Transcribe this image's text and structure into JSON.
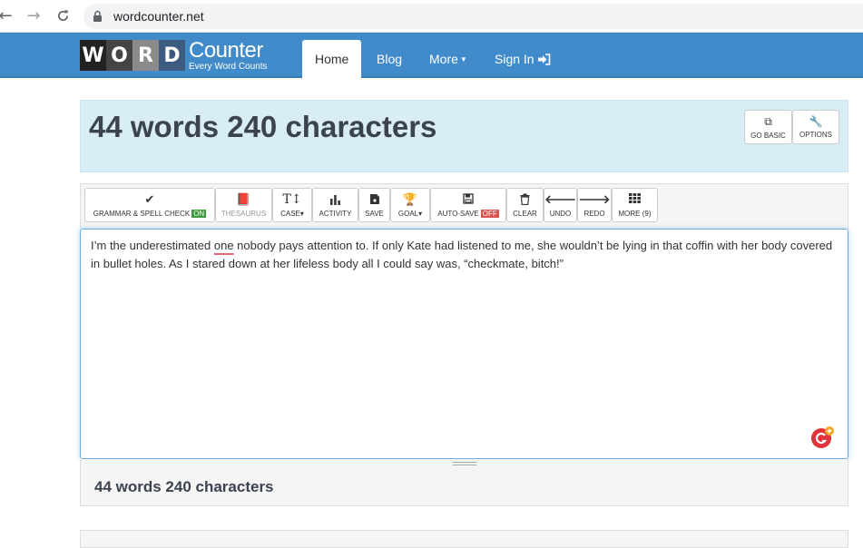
{
  "browser": {
    "url": "wordcounter.net"
  },
  "logo": {
    "letters": [
      "W",
      "O",
      "R",
      "D"
    ],
    "tile_colors": [
      "#222222",
      "#444444",
      "#888888",
      "#3d5a80"
    ],
    "counter": "Counter",
    "tagline": "Every Word Counts"
  },
  "nav": {
    "home": "Home",
    "blog": "Blog",
    "more": "More",
    "sign_in": "Sign In"
  },
  "header": {
    "title": "44 words 240 characters",
    "go_basic": "GO BASIC",
    "options": "OPTIONS"
  },
  "toolbar": {
    "grammar": "GRAMMAR & SPELL CHECK",
    "grammar_badge": "ON",
    "thesaurus": "THESAURUS",
    "case": "CASE",
    "activity": "ACTIVITY",
    "save": "SAVE",
    "goal": "GOAL",
    "auto_save": "AUTO-SAVE",
    "auto_save_badge": "OFF",
    "clear": "CLEAR",
    "undo": "UNDO",
    "redo": "REDO",
    "more": "MORE (9)"
  },
  "editor": {
    "text_before": "I’m the underestimated ",
    "underlined": "one",
    "text_after": " nobody pays attention to. If only Kate had listened to me, she wouldn’t be lying in that coffin with her body covered in bullet holes. As I stared down at her lifeless body all I could say was, “checkmate, bitch!”"
  },
  "footer": {
    "count": "44 words 240 characters"
  },
  "colors": {
    "navbar": "#428bca",
    "header_bg": "#d9edf7",
    "on_badge": "#3c9a3c",
    "off_badge": "#d9534f"
  }
}
